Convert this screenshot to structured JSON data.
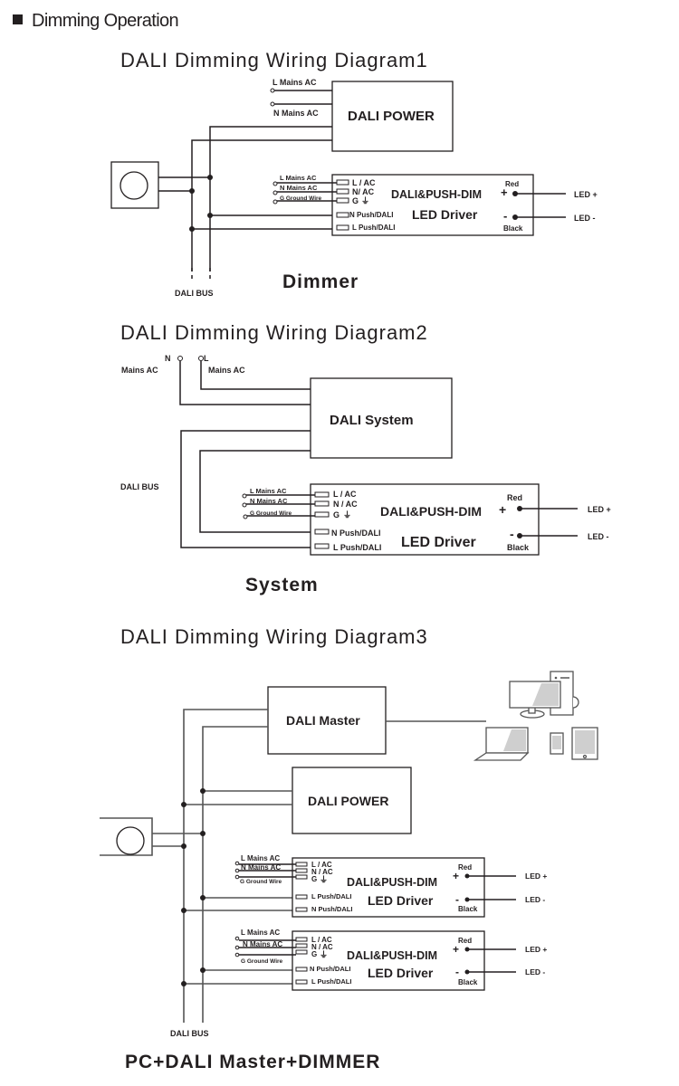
{
  "section": {
    "bullet_icon": "square-bullet",
    "title": "Dimming Operation"
  },
  "diagrams": [
    {
      "title": "DALI  Dimming  Wiring Diagram1",
      "caption": "Dimmer",
      "power_box": "DALI POWER",
      "mains": {
        "l": "L Mains AC",
        "n": "N Mains AC"
      },
      "bus_label": "DALI  BUS",
      "drivers": [
        {
          "inputs": [
            "L Mains AC",
            "N Mains AC",
            "G Ground Wire"
          ],
          "terminals": [
            "L / AC",
            "N/ AC",
            "G",
            "N Push/DALI",
            "L Push/DALI"
          ],
          "name_line1": "DALI&PUSH-DIM",
          "name_line2": "LED Driver",
          "pos_sign": "+",
          "neg_sign": "-",
          "red": "Red",
          "black": "Black",
          "led_pos": "LED +",
          "led_neg": "LED -"
        }
      ]
    },
    {
      "title": "DALI  Dimming  Wiring Diagram2",
      "caption": "System",
      "system_box": "DALI System",
      "mains": {
        "n": "N",
        "l": "L",
        "n_sub": "Mains AC",
        "l_sub": "Mains AC"
      },
      "bus_label": "DALI  BUS",
      "drivers": [
        {
          "inputs": [
            "L Mains AC",
            "N Mains AC",
            "G Ground Wire"
          ],
          "terminals": [
            "L / AC",
            "N / AC",
            "G",
            "N Push/DALI",
            "L Push/DALI"
          ],
          "name_line1": "DALI&PUSH-DIM",
          "name_line2": "LED Driver",
          "pos_sign": "+",
          "neg_sign": "-",
          "red": "Red",
          "black": "Black",
          "led_pos": "LED +",
          "led_neg": "LED -"
        }
      ]
    },
    {
      "title": "DALI  Dimming  Wiring Diagram3",
      "caption": "PC+DALI Master+DIMMER",
      "master_box": "DALI Master",
      "power_box": "DALI POWER",
      "bus_label": "DALI  BUS",
      "devices": [
        "desktop-monitor-icon",
        "pc-tower-icon",
        "laptop-icon",
        "smartphone-icon",
        "tablet-icon"
      ],
      "drivers": [
        {
          "inputs": [
            "L Mains AC",
            "N Mains AC",
            "G Ground Wire"
          ],
          "terminals": [
            "L / AC",
            "N / AC",
            "G",
            "L Push/DALI",
            "N Push/DALI"
          ],
          "name_line1": "DALI&PUSH-DIM",
          "name_line2": "LED Driver",
          "pos_sign": "+",
          "neg_sign": "-",
          "red": "Red",
          "black": "Black",
          "led_pos": "LED +",
          "led_neg": "LED -"
        },
        {
          "inputs": [
            "L Mains AC",
            "N Mains AC",
            "G Ground Wire"
          ],
          "terminals": [
            "L / AC",
            "N / AC",
            "G",
            "N Push/DALI",
            "L Push/DALI"
          ],
          "name_line1": "DALI&PUSH-DIM",
          "name_line2": "LED Driver",
          "pos_sign": "+",
          "neg_sign": "-",
          "red": "Red",
          "black": "Black",
          "led_pos": "LED +",
          "led_neg": "LED -"
        }
      ]
    }
  ]
}
